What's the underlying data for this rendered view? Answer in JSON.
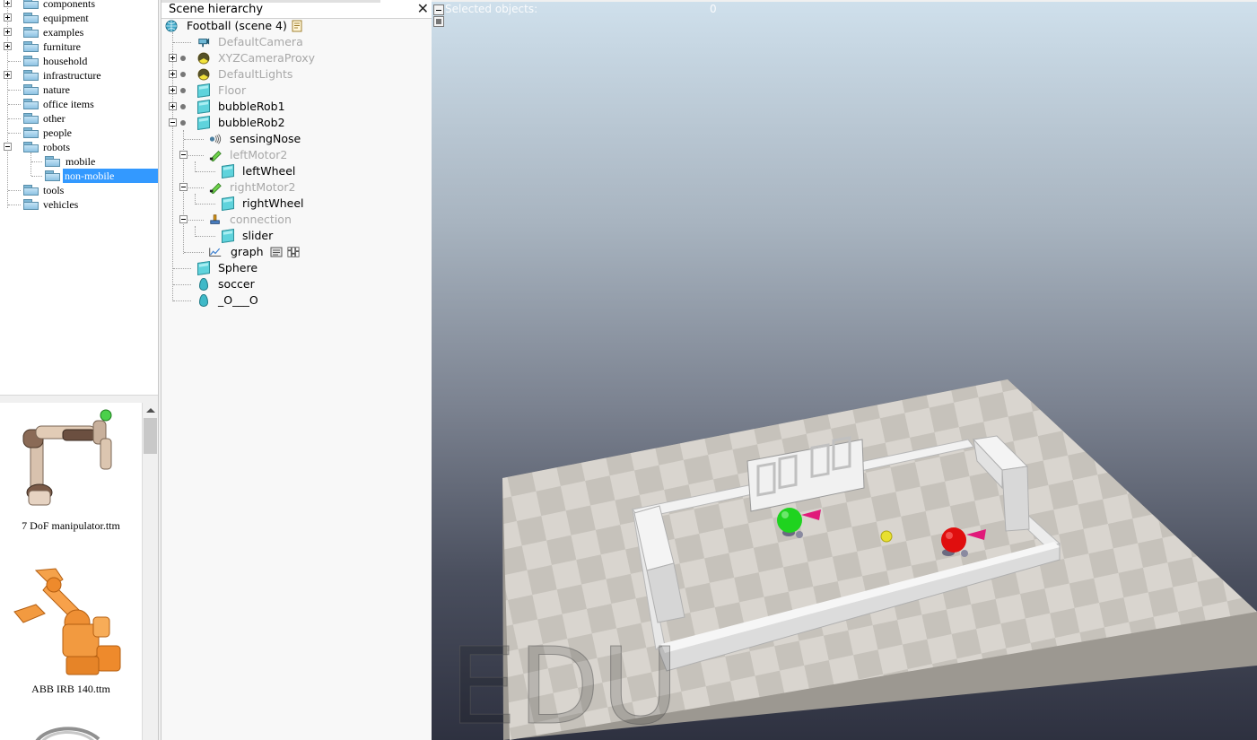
{
  "model_browser": {
    "folders": [
      {
        "label": "components",
        "expandable": true
      },
      {
        "label": "equipment",
        "expandable": true
      },
      {
        "label": "examples",
        "expandable": true
      },
      {
        "label": "furniture",
        "expandable": true
      },
      {
        "label": "household",
        "expandable": false
      },
      {
        "label": "infrastructure",
        "expandable": true
      },
      {
        "label": "nature",
        "expandable": false
      },
      {
        "label": "office items",
        "expandable": false
      },
      {
        "label": "other",
        "expandable": false
      },
      {
        "label": "people",
        "expandable": false
      },
      {
        "label": "robots",
        "expandable": true,
        "expanded": true
      },
      {
        "label": "mobile",
        "child": true
      },
      {
        "label": "non-mobile",
        "child": true,
        "selected": true
      },
      {
        "label": "tools",
        "expandable": false
      },
      {
        "label": "vehicles",
        "expandable": false
      }
    ],
    "thumbnails": [
      {
        "label": "7 DoF manipulator.ttm"
      },
      {
        "label": "ABB IRB 140.ttm"
      }
    ]
  },
  "scene_hierarchy": {
    "title": "Scene hierarchy",
    "close_label": "X",
    "root": "Football (scene 4)",
    "items": [
      {
        "label": "DefaultCamera",
        "icon": "camera-icon",
        "dim": true
      },
      {
        "label": "XYZCameraProxy",
        "icon": "proxy-icon",
        "dim": true
      },
      {
        "label": "DefaultLights",
        "icon": "lights-icon",
        "dim": true
      },
      {
        "label": "Floor",
        "icon": "shape-icon",
        "dim": true
      },
      {
        "label": "bubbleRob1",
        "icon": "shape-icon",
        "dim": false
      },
      {
        "label": "bubbleRob2",
        "icon": "shape-icon",
        "dim": false
      },
      {
        "label": "sensingNose",
        "icon": "proximity-sensor-icon",
        "dim": false
      },
      {
        "label": "leftMotor2",
        "icon": "joint-icon",
        "dim": true
      },
      {
        "label": "leftWheel",
        "icon": "shape-icon",
        "dim": false
      },
      {
        "label": "rightMotor2",
        "icon": "joint-icon",
        "dim": true
      },
      {
        "label": "rightWheel",
        "icon": "shape-icon",
        "dim": false
      },
      {
        "label": "connection",
        "icon": "force-sensor-icon",
        "dim": true
      },
      {
        "label": "slider",
        "icon": "shape-icon",
        "dim": false
      },
      {
        "label": "graph",
        "icon": "graph-icon",
        "dim": false
      },
      {
        "label": "Sphere",
        "icon": "shape-icon",
        "dim": false
      },
      {
        "label": "soccer",
        "icon": "dummy-icon",
        "dim": false
      },
      {
        "label": "_O___O",
        "icon": "dummy-icon",
        "dim": false
      }
    ]
  },
  "viewport": {
    "info_label": "Selected objects:",
    "info_count": "0",
    "watermark": "EDU"
  }
}
